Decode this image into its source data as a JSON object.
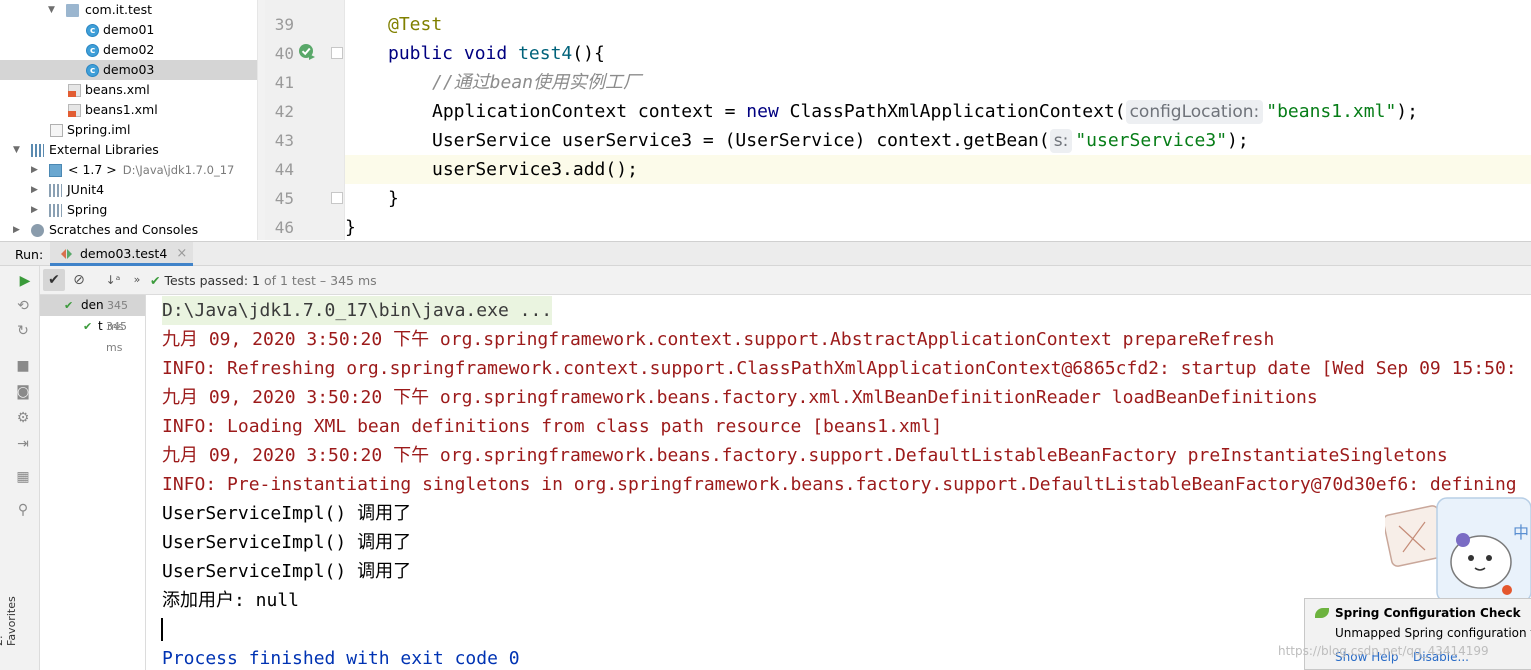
{
  "project_tree": {
    "items": [
      {
        "label": "com.it.test",
        "icon": "package-icon"
      },
      {
        "label": "demo01",
        "icon": "class-icon"
      },
      {
        "label": "demo02",
        "icon": "class-icon"
      },
      {
        "label": "demo03",
        "icon": "class-icon",
        "selected": true
      },
      {
        "label": "beans.xml",
        "icon": "xml-file-icon"
      },
      {
        "label": "beans1.xml",
        "icon": "xml-file-icon"
      },
      {
        "label": "Spring.iml",
        "icon": "iml-file-icon"
      },
      {
        "label": "External Libraries",
        "icon": "library-icon"
      },
      {
        "label": "< 1.7 >",
        "path": "D:\\Java\\jdk1.7.0_17",
        "icon": "jdk-icon"
      },
      {
        "label": "JUnit4",
        "icon": "jar-icon"
      },
      {
        "label": "Spring",
        "icon": "jar-icon"
      },
      {
        "label": "Scratches and Consoles",
        "icon": "scratches-icon"
      }
    ]
  },
  "editor": {
    "lines": [
      {
        "num": "39",
        "ann": "@Test"
      },
      {
        "num": "40",
        "kw1": "public",
        "kw2": "void",
        "fn": "test4",
        "rest": "(){"
      },
      {
        "num": "41",
        "comment": "//通过bean使用实例工厂"
      },
      {
        "num": "42",
        "pre": "ApplicationContext context = ",
        "kw": "new",
        "mid": " ClassPathXmlApplicationContext(",
        "hint": "configLocation:",
        "str": "\"beans1.xml\"",
        "post": ");"
      },
      {
        "num": "43",
        "pre": "UserService userService3 = (UserService) context.getBean(",
        "hint": "s:",
        "str": "\"userService3\"",
        "post": ");"
      },
      {
        "num": "44",
        "text": "userService3.add();"
      },
      {
        "num": "45",
        "text": "}"
      },
      {
        "num": "46",
        "text": "}"
      }
    ]
  },
  "run_panel": {
    "label": "Run:",
    "tab_label": "demo03.test4",
    "tab_close": "×",
    "status_prefix": "Tests passed:",
    "status_count": "1",
    "status_suffix": "of 1 test – 345 ms",
    "tree": [
      {
        "label": "den",
        "duration": "345 ms"
      },
      {
        "label": "t",
        "duration": "345 ms"
      }
    ],
    "favorites_label": "2: Favorites"
  },
  "console": {
    "lines": [
      {
        "text": "D:\\Java\\jdk1.7.0_17\\bin\\java.exe ...",
        "style": "cmd"
      },
      {
        "text": "九月 09, 2020 3:50:20 下午 org.springframework.context.support.AbstractApplicationContext prepareRefresh",
        "style": "red"
      },
      {
        "text": "INFO: Refreshing org.springframework.context.support.ClassPathXmlApplicationContext@6865cfd2: startup date [Wed Sep 09 15:50:",
        "style": "red"
      },
      {
        "text": "九月 09, 2020 3:50:20 下午 org.springframework.beans.factory.xml.XmlBeanDefinitionReader loadBeanDefinitions",
        "style": "red"
      },
      {
        "text": "INFO: Loading XML bean definitions from class path resource [beans1.xml]",
        "style": "red"
      },
      {
        "text": "九月 09, 2020 3:50:20 下午 org.springframework.beans.factory.support.DefaultListableBeanFactory preInstantiateSingletons",
        "style": "red"
      },
      {
        "text": "INFO: Pre-instantiating singletons in org.springframework.beans.factory.support.DefaultListableBeanFactory@70d30ef6: defining",
        "style": "red"
      },
      {
        "text": "UserServiceImpl() 调用了",
        "style": "normal"
      },
      {
        "text": "UserServiceImpl() 调用了",
        "style": "normal"
      },
      {
        "text": "UserServiceImpl() 调用了",
        "style": "normal"
      },
      {
        "text": "添加用户: null",
        "style": "normal"
      },
      {
        "text": "",
        "style": "normal"
      },
      {
        "text": "Process finished with exit code 0",
        "style": "blue"
      }
    ]
  },
  "notification": {
    "title": "Spring Configuration Check",
    "text": "Unmapped Spring configuration f",
    "show_help": "Show Help",
    "disable": "Disable..."
  },
  "watermark": "https://blog.csdn.net/qq_43414199",
  "colors": {
    "annotation": "#808000",
    "keyword": "#000080",
    "string": "#067d17",
    "log_red": "#9c1a1a",
    "exit_blue": "#0033b3",
    "selection": "#d5d5d5",
    "tab_underline": "#4083c9"
  }
}
